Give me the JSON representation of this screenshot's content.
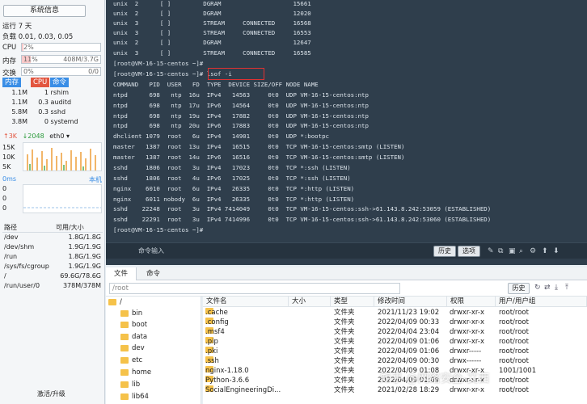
{
  "sidebar": {
    "sysinfo_button": "系统信息",
    "uptime": "运行 7 天",
    "load": "负载 0.01, 0.03, 0.05",
    "cpu": {
      "label": "CPU",
      "value": "2%",
      "fraction": 0.02
    },
    "mem": {
      "label": "内存",
      "percent": "11%",
      "value": "408M/3.7G",
      "fraction": 0.11
    },
    "swap": {
      "label": "交换",
      "percent": "0%",
      "value": "0/0",
      "fraction": 0.0
    },
    "proc_tabs": [
      "内存",
      "CPU",
      "命令"
    ],
    "processes": [
      {
        "mem": "1.1M",
        "cpu": "1",
        "cmd": "rshim"
      },
      {
        "mem": "1.1M",
        "cpu": "0.3",
        "cmd": "auditd"
      },
      {
        "mem": "5.8M",
        "cpu": "0.3",
        "cmd": "sshd"
      },
      {
        "mem": "3.8M",
        "cpu": "0",
        "cmd": "systemd"
      }
    ],
    "net": {
      "up": "↑3K",
      "down": "↓2048",
      "iface": "eth0 ▾",
      "scale": [
        "15K",
        "10K",
        "5K"
      ]
    },
    "ping": {
      "ms": "0ms",
      "host": "本机",
      "values": [
        "0",
        "0",
        "0"
      ]
    },
    "disk_header": {
      "path": "路径",
      "size": "可用/大小"
    },
    "disks": [
      {
        "path": "/dev",
        "size": "1.8G/1.8G"
      },
      {
        "path": "/dev/shm",
        "size": "1.9G/1.9G"
      },
      {
        "path": "/run",
        "size": "1.8G/1.9G"
      },
      {
        "path": "/sys/fs/cgroup",
        "size": "1.9G/1.9G"
      },
      {
        "path": "/",
        "size": "69.6G/78.6G"
      },
      {
        "path": "/run/user/0",
        "size": "378M/378M"
      }
    ],
    "upgrade": "激活/升级"
  },
  "terminal": {
    "lines": [
      "unix  2      [ ]         DGRAM                    15661",
      "unix  2      [ ]         DGRAM                    12020",
      "unix  3      [ ]         STREAM     CONNECTED     16568",
      "unix  3      [ ]         STREAM     CONNECTED     16553",
      "unix  2      [ ]         DGRAM                    12647",
      "unix  3      [ ]         STREAM     CONNECTED     16585",
      "[root@VM-16-15-centos ~]#",
      "[root@VM-16-15-centos ~]# lsof -i",
      "COMMAND   PID  USER   FD  TYPE  DEVICE SIZE/OFF NODE NAME",
      "ntpd      698   ntp  16u  IPv4   14563     0t0  UDP VM-16-15-centos:ntp",
      "ntpd      698   ntp  17u  IPv6   14564     0t0  UDP VM-16-15-centos:ntp",
      "ntpd      698   ntp  19u  IPv4   17882     0t0  UDP VM-16-15-centos:ntp",
      "ntpd      698   ntp  20u  IPv6   17883     0t0  UDP VM-16-15-centos:ntp",
      "dhclient 1079  root   6u  IPv4   14901     0t0  UDP *:bootpc",
      "master   1387  root  13u  IPv4   16515     0t0  TCP VM-16-15-centos:smtp (LISTEN)",
      "master   1387  root  14u  IPv6   16516     0t0  TCP VM-16-15-centos:smtp (LISTEN)",
      "sshd     1806  root   3u  IPv4   17023     0t0  TCP *:ssh (LISTEN)",
      "sshd     1806  root   4u  IPv6   17025     0t0  TCP *:ssh (LISTEN)",
      "nginx    6010  root   6u  IPv4   26335     0t0  TCP *:http (LISTEN)",
      "nginx    6011 nobody  6u  IPv4   26335     0t0  TCP *:http (LISTEN)",
      "sshd    22248  root   3u  IPv4 7414049     0t0  TCP VM-16-15-centos:ssh->61.143.8.242:53059 (ESTABLISHED)",
      "sshd    22291  root   3u  IPv4 7414996     0t0  TCP VM-16-15-centos:ssh->61.143.8.242:53060 (ESTABLISHED)",
      "[root@VM-16-15-centos ~]#"
    ],
    "command_input": "命令输入",
    "history_button": "历史",
    "options_button": "选项"
  },
  "files": {
    "tabs": [
      "文件",
      "命令"
    ],
    "path": "/root",
    "history_button": "历史",
    "tree": [
      "/",
      "bin",
      "boot",
      "data",
      "dev",
      "etc",
      "home",
      "lib",
      "lib64"
    ],
    "columns": [
      "文件名",
      "大小",
      "类型",
      "修改时间",
      "权限",
      "用户/用户组"
    ],
    "rows": [
      {
        "name": ".cache",
        "size": "",
        "type": "文件夹",
        "time": "2021/11/23 19:02",
        "perm": "drwxr-xr-x",
        "owner": "root/root"
      },
      {
        "name": ".config",
        "size": "",
        "type": "文件夹",
        "time": "2022/04/09 00:33",
        "perm": "drwxr-xr-x",
        "owner": "root/root"
      },
      {
        "name": ".msf4",
        "size": "",
        "type": "文件夹",
        "time": "2022/04/04 23:04",
        "perm": "drwxr-xr-x",
        "owner": "root/root"
      },
      {
        "name": ".pip",
        "size": "",
        "type": "文件夹",
        "time": "2022/04/09 01:06",
        "perm": "drwxr-xr-x",
        "owner": "root/root"
      },
      {
        "name": ".pki",
        "size": "",
        "type": "文件夹",
        "time": "2022/04/09 01:06",
        "perm": "drwxr-----",
        "owner": "root/root"
      },
      {
        "name": ".ssh",
        "size": "",
        "type": "文件夹",
        "time": "2022/04/09 00:30",
        "perm": "drwx------",
        "owner": "root/root"
      },
      {
        "name": "nginx-1.18.0",
        "size": "",
        "type": "文件夹",
        "time": "2022/04/09 01:08",
        "perm": "drwxr-xr-x",
        "owner": "1001/1001"
      },
      {
        "name": "Python-3.6.6",
        "size": "",
        "type": "文件夹",
        "time": "2022/04/09 01:09",
        "perm": "drwxr-xr-x",
        "owner": "root/root"
      },
      {
        "name": "SocialEngineeringDi...",
        "size": "",
        "type": "文件夹",
        "time": "2021/02/28 18:29",
        "perm": "drwxr-xr-x",
        "owner": "root/root"
      }
    ]
  },
  "watermark": "知乎 @网络安全-艾西",
  "colors": {
    "terminal_bg": "#2f3e4c",
    "tab_active": "#3a8ee6",
    "tab_cpu": "#e2553f",
    "highlight": "#e23232",
    "folder": "#f5c24a"
  }
}
